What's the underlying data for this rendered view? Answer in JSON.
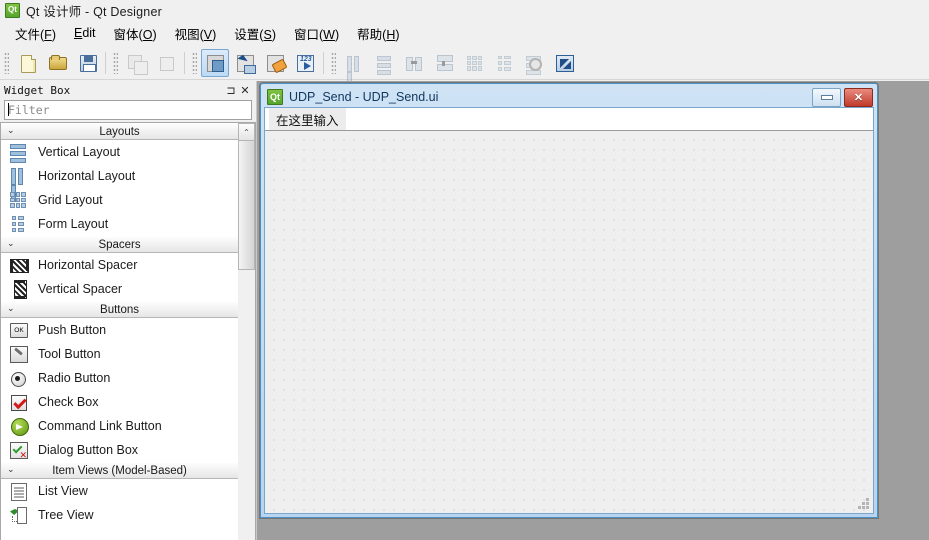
{
  "window": {
    "app_icon": "qt-logo-icon",
    "app_icon_text": "Qt",
    "title": "Qt 设计师 - Qt Designer"
  },
  "menubar": {
    "items": [
      {
        "label": "文件(F)",
        "mnemonic": "F"
      },
      {
        "label": "Edit",
        "mnemonic": "E"
      },
      {
        "label": "窗体(O)",
        "mnemonic": "O"
      },
      {
        "label": "视图(V)",
        "mnemonic": "V"
      },
      {
        "label": "设置(S)",
        "mnemonic": "S"
      },
      {
        "label": "窗口(W)",
        "mnemonic": "W"
      },
      {
        "label": "帮助(H)",
        "mnemonic": "H"
      }
    ]
  },
  "toolbar": {
    "file_group": [
      {
        "name": "new-form-button",
        "icon": "new-file-icon",
        "enabled": true
      },
      {
        "name": "open-form-button",
        "icon": "open-folder-icon",
        "enabled": true
      },
      {
        "name": "save-form-button",
        "icon": "save-disk-icon",
        "enabled": true
      }
    ],
    "edit_group": [
      {
        "name": "cut-button",
        "icon": "copy-stack-icon",
        "enabled": false
      },
      {
        "name": "paste-button",
        "icon": "single-page-icon",
        "enabled": false
      }
    ],
    "mode_group": [
      {
        "name": "edit-widgets-button",
        "icon": "edit-widgets-icon",
        "selected": true
      },
      {
        "name": "edit-signals-slots-button",
        "icon": "signal-slot-icon",
        "selected": false
      },
      {
        "name": "edit-buddies-button",
        "icon": "buddy-tag-icon",
        "selected": false
      },
      {
        "name": "edit-tab-order-button",
        "icon": "tab-order-123-icon",
        "selected": false
      }
    ],
    "layout_group": [
      {
        "name": "lay-out-horizontally-button",
        "icon": "horizontal-layout-icon",
        "enabled": false
      },
      {
        "name": "lay-out-vertically-button",
        "icon": "vertical-layout-icon",
        "enabled": false
      },
      {
        "name": "lay-out-horizontally-splitter-button",
        "icon": "splitter-horizontal-icon",
        "enabled": false
      },
      {
        "name": "lay-out-vertically-splitter-button",
        "icon": "splitter-vertical-icon",
        "enabled": false
      },
      {
        "name": "lay-out-grid-button",
        "icon": "grid-layout-icon",
        "enabled": false
      },
      {
        "name": "lay-out-form-button",
        "icon": "form-layout-icon",
        "enabled": false
      },
      {
        "name": "break-layout-button",
        "icon": "break-layout-icon",
        "enabled": false
      },
      {
        "name": "adjust-size-button",
        "icon": "adjust-size-icon",
        "enabled": true
      }
    ]
  },
  "widget_box": {
    "title": "Widget Box",
    "float_button": "⊐",
    "close_button": "✕",
    "filter_placeholder": "Filter",
    "filter_value": "",
    "scroll_up_arrow": "⌃",
    "categories": [
      {
        "name": "Layouts",
        "chevron": "⌄",
        "expanded": true,
        "items": [
          {
            "label": "Vertical Layout",
            "icon": "vertical-layout-icon"
          },
          {
            "label": "Horizontal Layout",
            "icon": "horizontal-layout-icon"
          },
          {
            "label": "Grid Layout",
            "icon": "grid-layout-icon"
          },
          {
            "label": "Form Layout",
            "icon": "form-layout-icon"
          }
        ]
      },
      {
        "name": "Spacers",
        "chevron": "⌄",
        "expanded": true,
        "items": [
          {
            "label": "Horizontal Spacer",
            "icon": "horizontal-spacer-icon"
          },
          {
            "label": "Vertical Spacer",
            "icon": "vertical-spacer-icon"
          }
        ]
      },
      {
        "name": "Buttons",
        "chevron": "⌄",
        "expanded": true,
        "items": [
          {
            "label": "Push Button",
            "icon": "push-button-icon",
            "icon_text": "OK"
          },
          {
            "label": "Tool Button",
            "icon": "tool-button-icon"
          },
          {
            "label": "Radio Button",
            "icon": "radio-button-icon"
          },
          {
            "label": "Check Box",
            "icon": "check-box-icon"
          },
          {
            "label": "Command Link Button",
            "icon": "command-link-icon"
          },
          {
            "label": "Dialog Button Box",
            "icon": "dialog-button-box-icon"
          }
        ]
      },
      {
        "name": "Item Views (Model-Based)",
        "chevron": "⌄",
        "expanded": true,
        "items": [
          {
            "label": "List View",
            "icon": "list-view-icon"
          },
          {
            "label": "Tree View",
            "icon": "tree-view-icon"
          }
        ]
      }
    ]
  },
  "mdi_child": {
    "icon": "qt-logo-icon",
    "icon_text": "Qt",
    "title": "UDP_Send - UDP_Send.ui",
    "minimize_label": "",
    "close_label": "✕",
    "form_menubar_placeholder": "在这里输入"
  },
  "colors": {
    "window_bg": "#f0f0f0",
    "mdi_bg": "#9e9e9e",
    "mdi_frame": "#bdd7ef",
    "mdi_border": "#4a90c4",
    "title_text": "#11365c",
    "canvas_bg": "#efefef",
    "canvas_dot": "#b8b8b8",
    "selected_tool": "#bcd9f5",
    "close_button": "#c03a2b",
    "qt_green": "#55a52c"
  }
}
